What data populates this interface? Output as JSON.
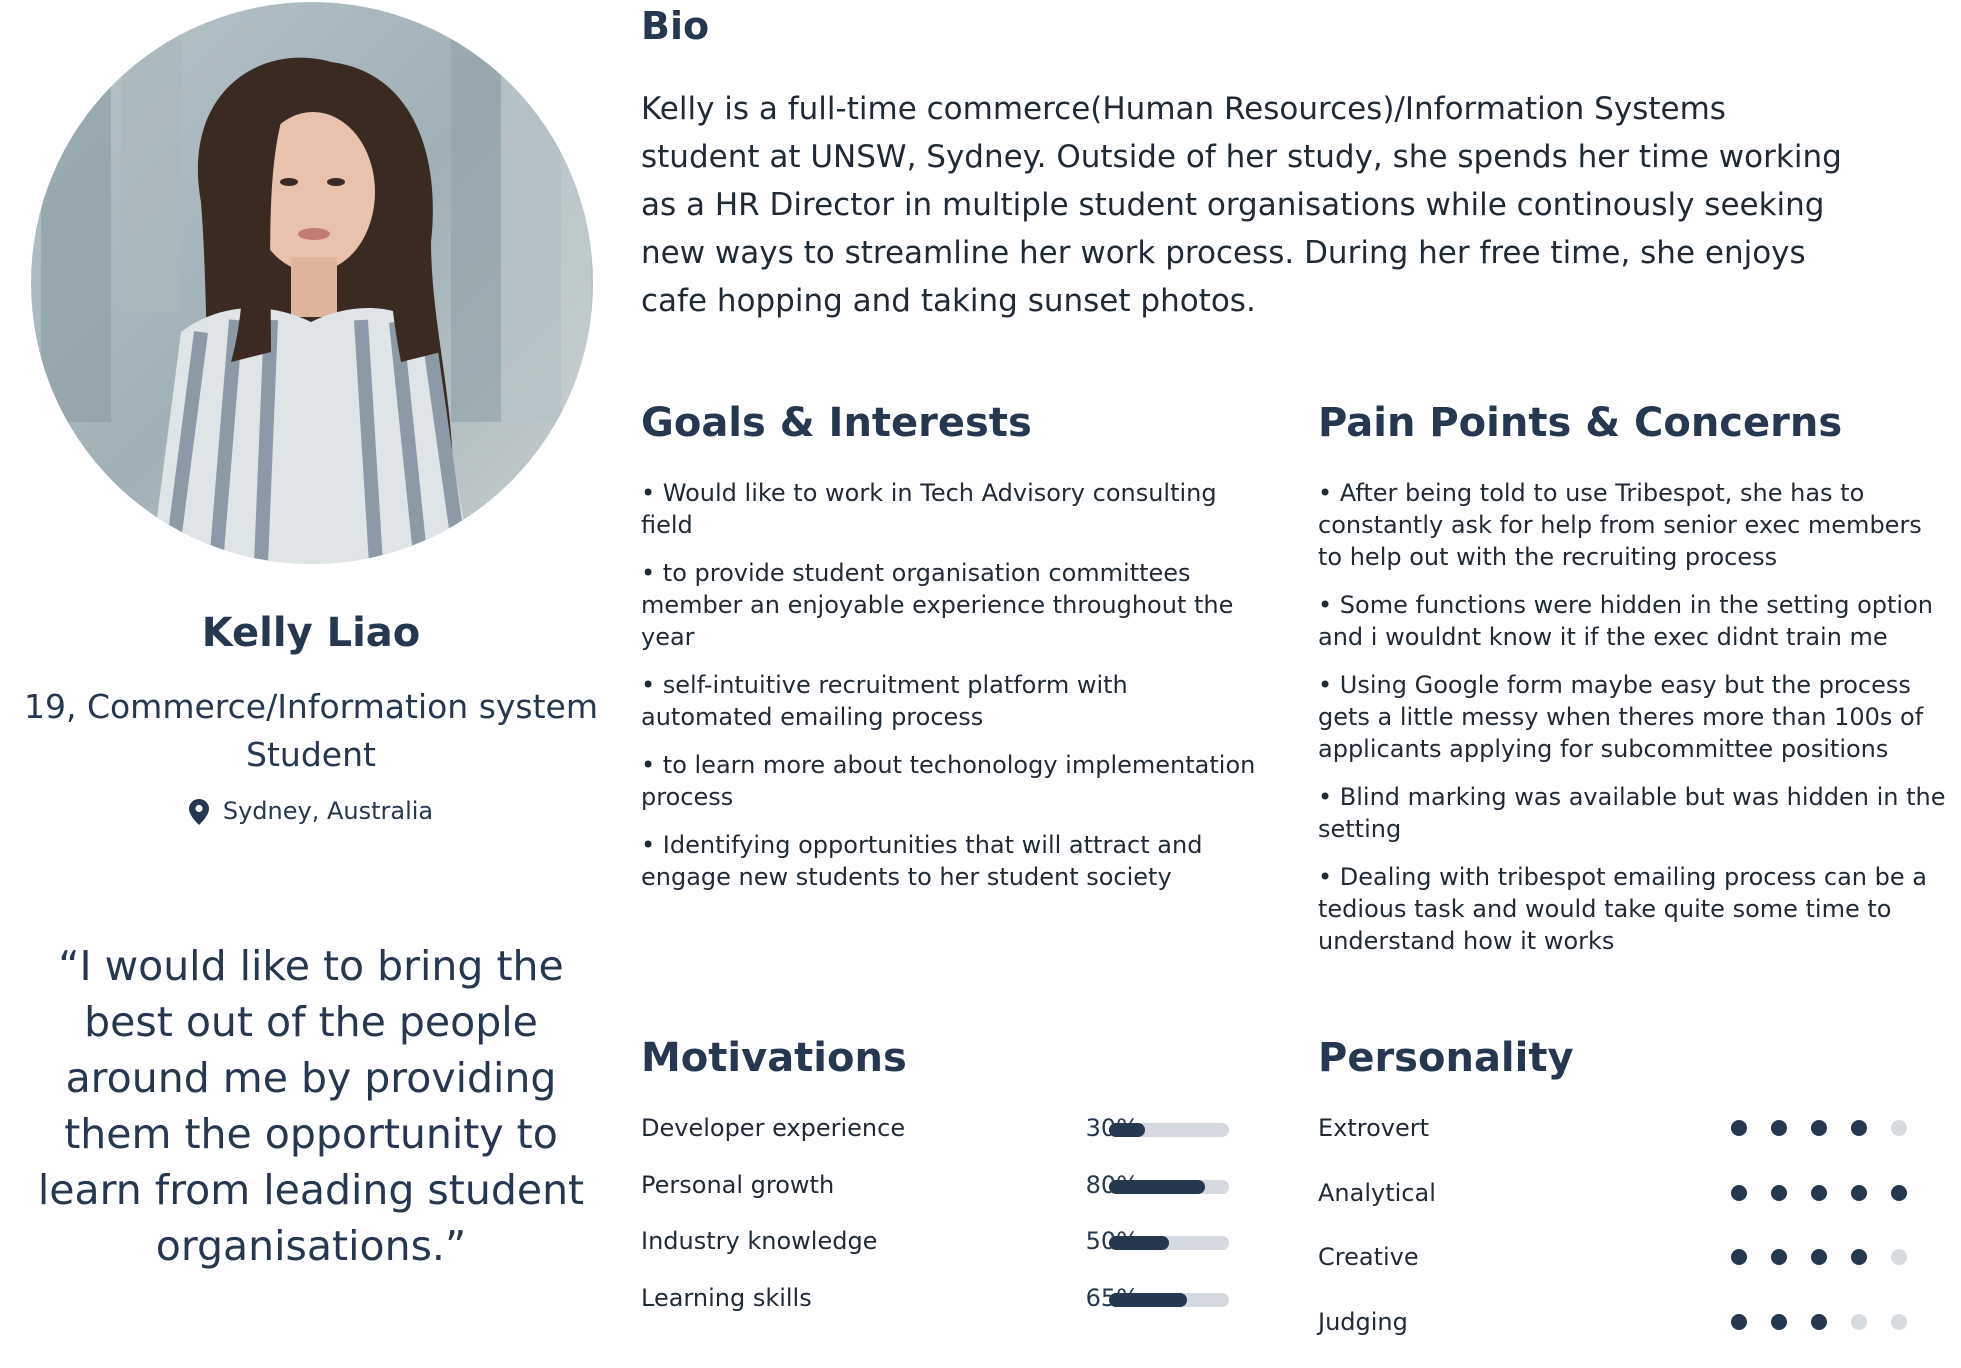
{
  "profile": {
    "name": "Kelly Liao",
    "role_line1": "19, Commerce/Information system",
    "role_line2": "Student",
    "location": "Sydney, Australia",
    "quote_lines": [
      "“I would like to bring the",
      "best out of the people",
      "around me by providing",
      "them the opportunity to",
      "learn from leading student",
      "organisations.”"
    ]
  },
  "bio": {
    "title": "Bio",
    "lines": [
      "Kelly is a full-time commerce(Human Resources)/Information Systems",
      "student at UNSW, Sydney. Outside of her study, she spends her time working",
      "as a HR Director in multiple student organisations while continously seeking",
      "new ways to streamline her work process. During her free time, she enjoys",
      "cafe hopping and taking sunset photos."
    ]
  },
  "goals": {
    "title": "Goals & Interests",
    "items": [
      [
        "• Would like to work in Tech Advisory consulting",
        "field"
      ],
      [
        "• to provide student organisation committees",
        "member an enjoyable experience throughout the",
        "year"
      ],
      [
        "• self-intuitive recruitment platform with",
        "automated emailing process"
      ],
      [
        "• to learn more about techonology implementation",
        "process"
      ],
      [
        "• Identifying opportunities that will attract and",
        "engage new students to her student society"
      ]
    ]
  },
  "pain_points": {
    "title": "Pain Points & Concerns",
    "items": [
      [
        "• After being told to use Tribespot, she has to",
        "constantly ask for help from senior exec members",
        "to help out with  the recruiting process"
      ],
      [
        "• Some functions were hidden in the setting option",
        "and i wouldnt know it if the exec didnt train me"
      ],
      [
        "• Using Google form maybe easy but the process",
        "gets a little messy when theres more than 100s of",
        "applicants applying for subcommittee positions"
      ],
      [
        "• Blind marking was available but was hidden in the",
        "setting"
      ],
      [
        "• Dealing with tribespot emailing process can be a",
        "tedious task and would take quite some time to",
        "understand how it works"
      ]
    ]
  },
  "motivations": {
    "title": "Motivations",
    "items": [
      {
        "label": "Developer experience",
        "pct_text": "30%",
        "value": 0.3
      },
      {
        "label": "Personal growth",
        "pct_text": "80%",
        "value": 0.8
      },
      {
        "label": "Industry knowledge",
        "pct_text": "50%",
        "value": 0.5
      },
      {
        "label": "Learning skills",
        "pct_text": "65%",
        "value": 0.65
      }
    ]
  },
  "personality": {
    "title": "Personality",
    "max": 5,
    "items": [
      {
        "label": "Extrovert",
        "level": 4
      },
      {
        "label": "Analytical",
        "level": 5
      },
      {
        "label": "Creative",
        "level": 4
      },
      {
        "label": "Judging",
        "level": 3
      }
    ]
  },
  "colors": {
    "accent": "#26384f",
    "track": "#d3d9df",
    "dot_off": "#d6dbe0"
  },
  "icons": {
    "location": "map-pin-icon"
  }
}
